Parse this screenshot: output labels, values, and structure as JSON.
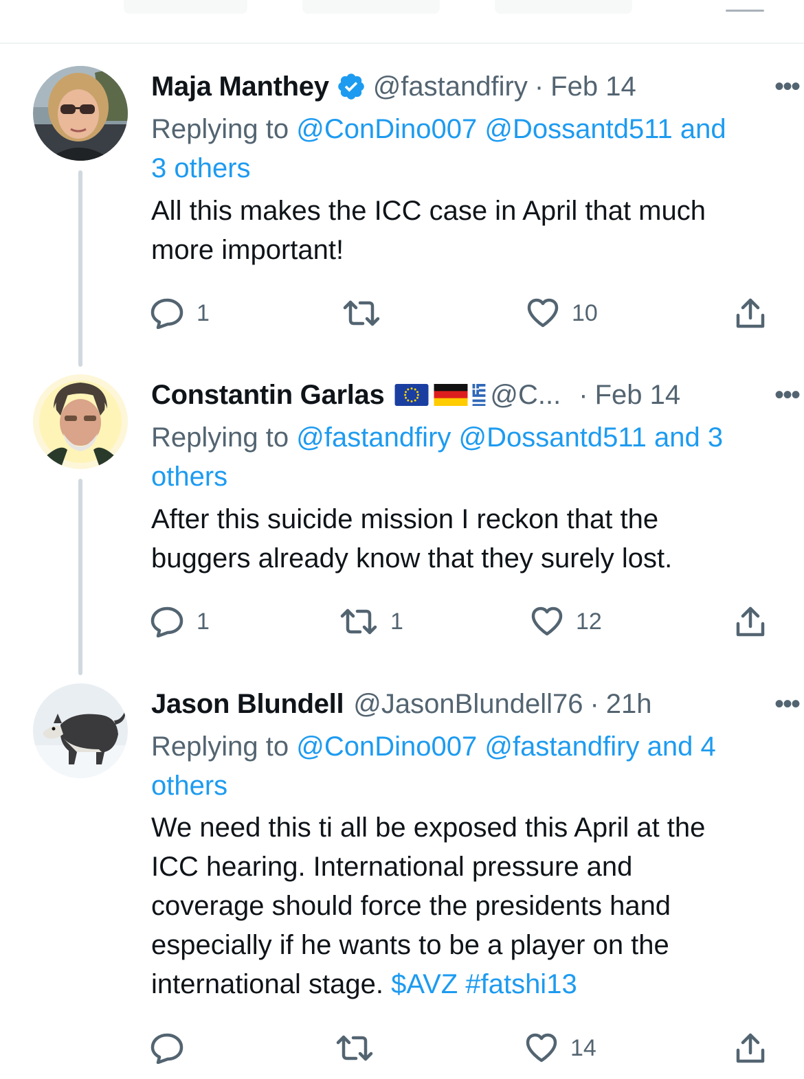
{
  "colors": {
    "link": "#1d9bf0",
    "muted": "#536471",
    "text": "#0f1419",
    "verified": "#1d9bf0",
    "thread_line": "#cfd9de"
  },
  "tweets": [
    {
      "name": "Maja Manthey",
      "verified": true,
      "handle": "@fastandfiry",
      "time": "Feb 14",
      "more": "•••",
      "reply_prefix": "Replying to",
      "reply_mentions": "@ConDino007 @Dossantd511 and",
      "reply_mentions_2": "3 others",
      "text": "All this makes the ICC case in April that much",
      "text_2": "more important!",
      "replies": "1",
      "retweets": "",
      "likes": "10",
      "avatar": "woman-with-sunglasses-avatar"
    },
    {
      "name": "Constantin Garlas",
      "flags": [
        "eu-flag",
        "germany-flag",
        "greece-flag"
      ],
      "handle": "@C...",
      "time": "Feb 14",
      "more": "•••",
      "reply_prefix": "Replying to",
      "reply_mentions": "@fastandfiry @Dossantd511 and 3",
      "reply_mentions_2": "others",
      "text": "After this suicide mission I reckon that the",
      "text_2": "buggers already know that they surely lost.",
      "replies": "1",
      "retweets": "1",
      "likes": "12",
      "avatar": "bearded-man-avatar"
    },
    {
      "name": "Jason Blundell",
      "handle": "@JasonBlundell76",
      "time": "21h",
      "more": "•••",
      "reply_prefix": "Replying to",
      "reply_mentions": "@ConDino007 @fastandfiry and 4",
      "reply_mentions_2": "others",
      "text_lines": [
        "We need this ti all be exposed  this April at the",
        "ICC hearing. International pressure and",
        "coverage should force the presidents hand",
        "especially if he wants to be a player on the"
      ],
      "text_last": "international stage.",
      "cashtag": "$AVZ",
      "hashtag": "#fatshi13",
      "replies": "",
      "retweets": "",
      "likes": "14",
      "avatar": "husky-dog-avatar"
    }
  ]
}
